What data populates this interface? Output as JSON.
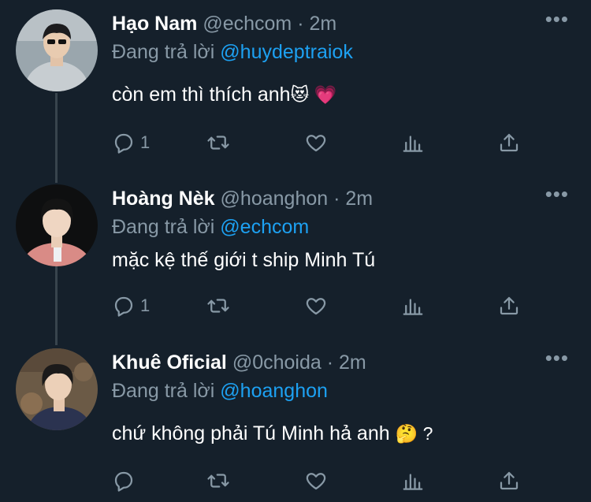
{
  "tweets": [
    {
      "name": "Hạo Nam",
      "handle": "@echcom",
      "time": "2m",
      "replying_prefix": "Đang trả lời",
      "replying_to": "@huydeptraiok",
      "text": "còn em thì thích anh",
      "emojis": "😻 💗",
      "reply_count": "1",
      "avatar_colors": {
        "bg": "#9aa6ad",
        "shirt": "#c7cdd1",
        "hair": "#1c1c1e"
      }
    },
    {
      "name": "Hoàng Nèk",
      "handle": "@hoanghon",
      "time": "2m",
      "replying_prefix": "Đang trả lời",
      "replying_to": "@echcom",
      "text": "mặc kệ thế giới t ship Minh Tú",
      "emojis": "",
      "reply_count": "1",
      "avatar_colors": {
        "bg": "#0e0f10",
        "shirt": "#d98b86",
        "hair": "#141414"
      }
    },
    {
      "name": "Khuê Oficial",
      "handle": "@0choida",
      "time": "2m",
      "replying_prefix": "Đang trả lời",
      "replying_to": "@hoanghon",
      "text": "chứ không phải Tú Minh hả anh",
      "emojis": "🤔 ?",
      "reply_count": "",
      "avatar_colors": {
        "bg": "#6b5a46",
        "shirt": "#2b3350",
        "hair": "#1b1a1a"
      }
    }
  ],
  "dot": "·",
  "icons": [
    "reply-icon",
    "retweet-icon",
    "like-icon",
    "analytics-icon",
    "share-icon",
    "more-icon"
  ],
  "colors": {
    "background": "#15202b",
    "muted": "#8899a6",
    "link": "#1da1f2",
    "thread": "#38444d"
  }
}
